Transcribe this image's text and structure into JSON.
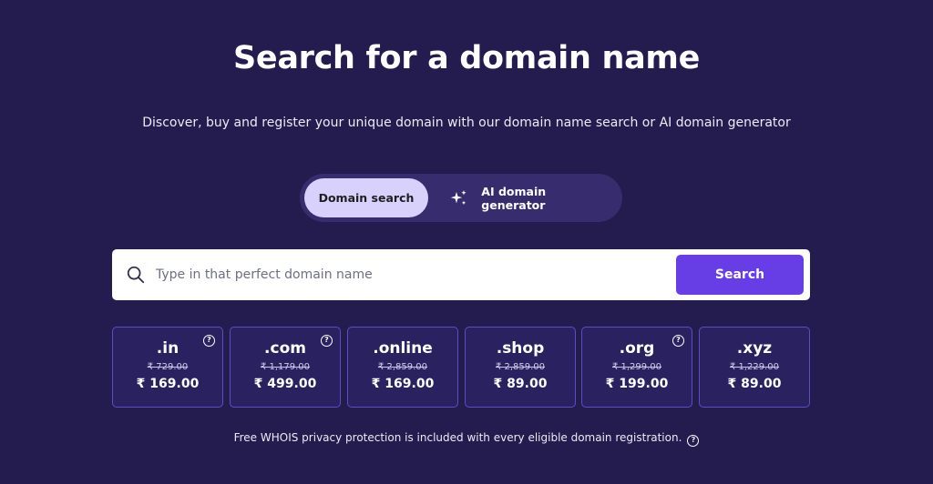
{
  "hero": {
    "title": "Search for a domain name",
    "subtitle": "Discover, buy and register your unique domain with our domain name search or AI domain generator"
  },
  "tabs": {
    "domain_search": "Domain search",
    "ai_generator": "AI domain generator",
    "ai_icon": "sparkles-icon"
  },
  "search": {
    "placeholder": "Type in that perfect domain name",
    "value": "",
    "button_label": "Search",
    "icon": "search-icon"
  },
  "tlds": [
    {
      "name": ".in",
      "old_price": "₹ 729.00",
      "price": "₹ 169.00",
      "help": true
    },
    {
      "name": ".com",
      "old_price": "₹ 1,179.00",
      "price": "₹ 499.00",
      "help": true
    },
    {
      "name": ".online",
      "old_price": "₹ 2,859.00",
      "price": "₹ 169.00",
      "help": false
    },
    {
      "name": ".shop",
      "old_price": "₹ 2,859.00",
      "price": "₹ 89.00",
      "help": false
    },
    {
      "name": ".org",
      "old_price": "₹ 1,299.00",
      "price": "₹ 199.00",
      "help": true
    },
    {
      "name": ".xyz",
      "old_price": "₹ 1,229.00",
      "price": "₹ 89.00",
      "help": false
    }
  ],
  "help_glyph": "?",
  "footnote": "Free WHOIS privacy protection is included with every eligible domain registration.",
  "colors": {
    "background": "#241c4e",
    "accent": "#673de6",
    "tab_active": "#d7d1fb",
    "card_border": "#5b4dc6"
  }
}
